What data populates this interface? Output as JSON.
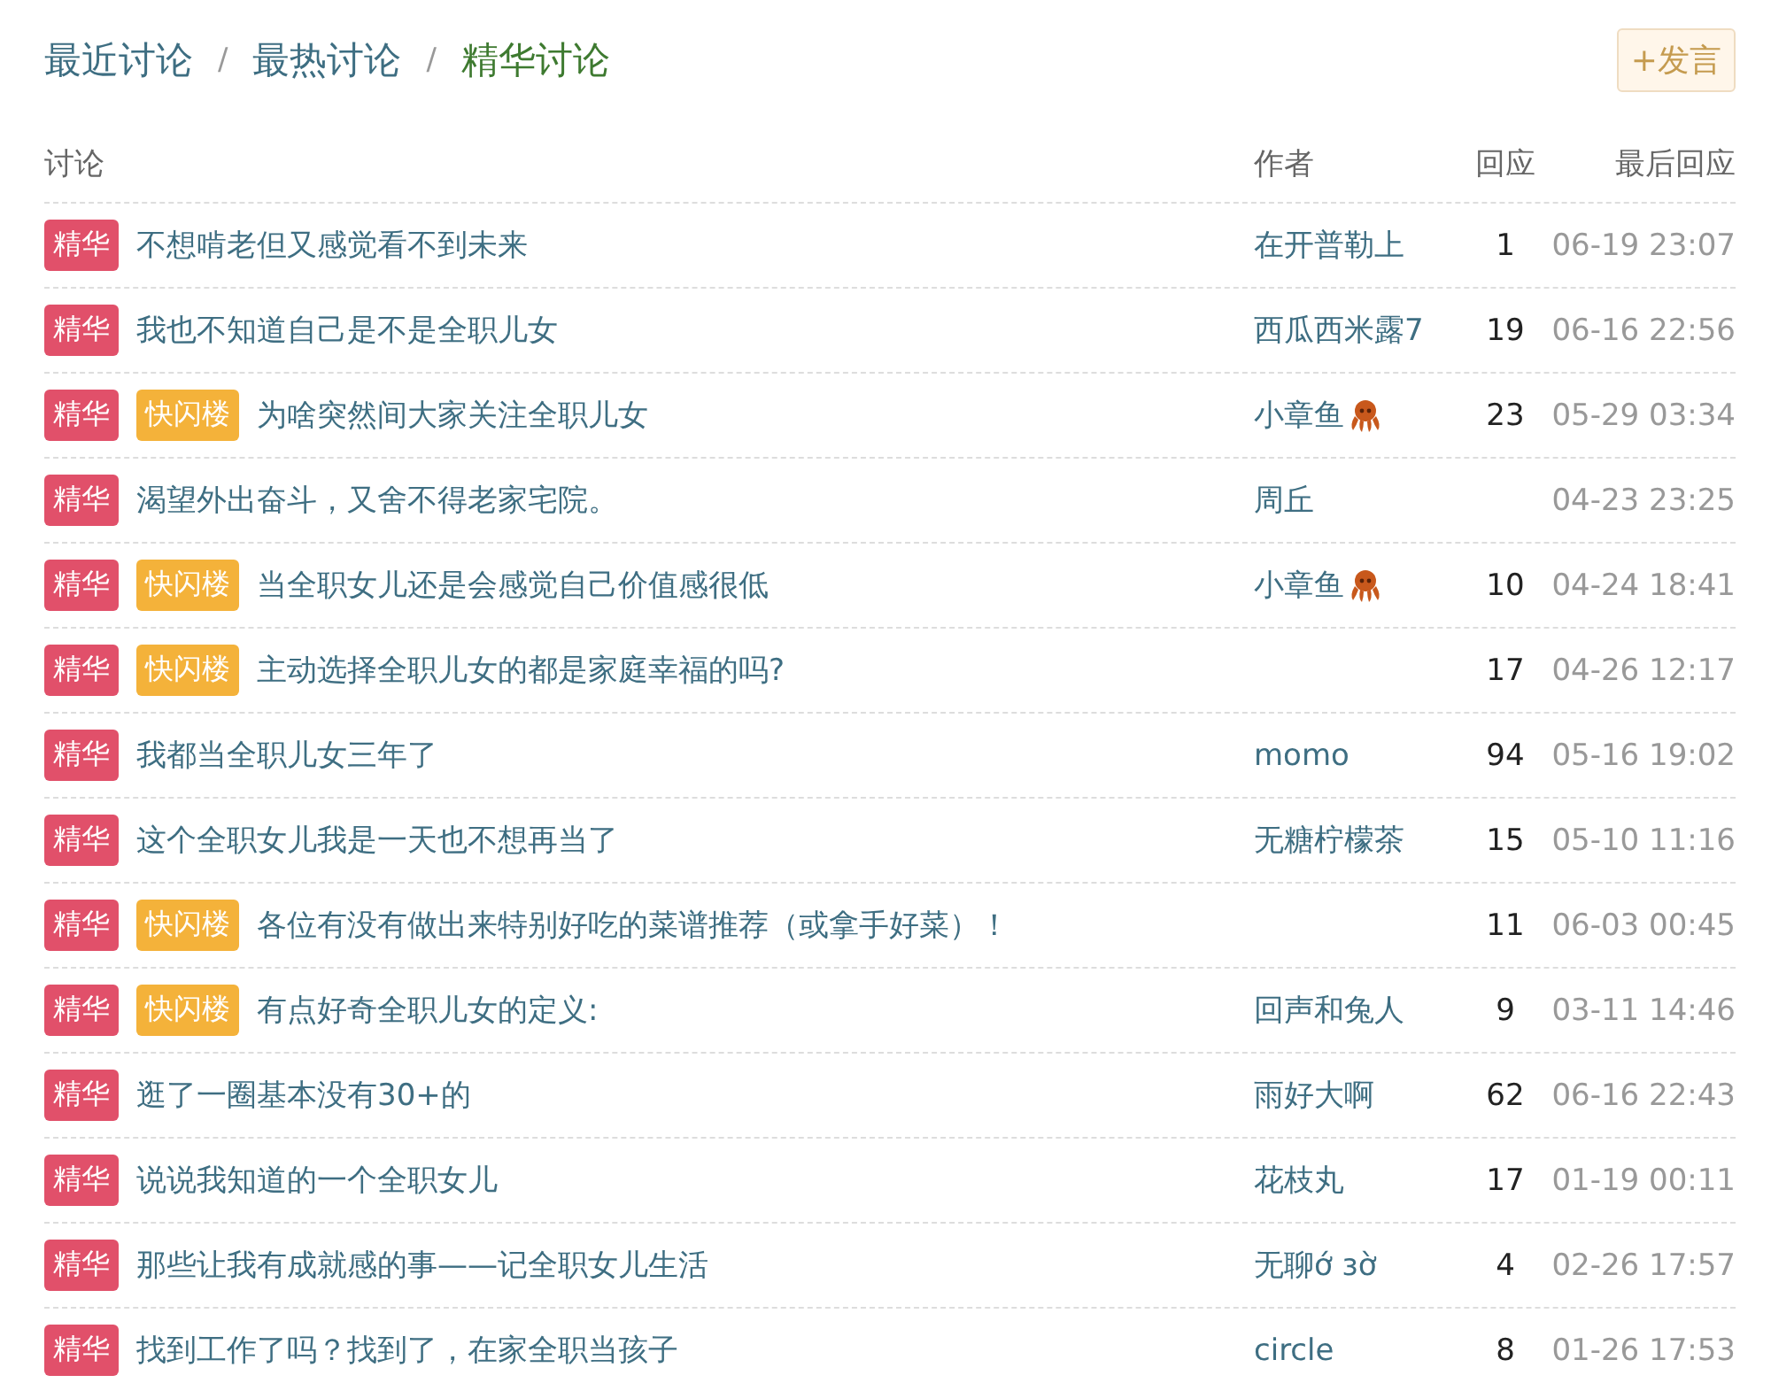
{
  "nav": [
    {
      "label": "最近讨论",
      "selected": false
    },
    {
      "label": "最热讨论",
      "selected": false
    },
    {
      "label": "精华讨论",
      "selected": true
    }
  ],
  "separators": [
    "/",
    "/"
  ],
  "post_button": "+发言",
  "columns": [
    "讨论",
    "作者",
    "回应",
    "最后回应"
  ],
  "rows": [
    {
      "tags": [
        {
          "kind": "elite",
          "label": "精华"
        }
      ],
      "title": "不想啃老但又感觉看不到未来",
      "author": "在开普勒上",
      "replies": "1",
      "last_reply": "06-19 23:07"
    },
    {
      "tags": [
        {
          "kind": "elite",
          "label": "精华"
        }
      ],
      "title": "我也不知道自己是不是全职儿女",
      "author": "西瓜西米露7",
      "replies": "19",
      "last_reply": "06-16 22:56"
    },
    {
      "tags": [
        {
          "kind": "elite",
          "label": "精华"
        },
        {
          "kind": "flash",
          "label": "快闪楼"
        }
      ],
      "title": "为啥突然间大家关注全职儿女",
      "author": "小章鱼",
      "author_badge": true,
      "replies": "23",
      "last_reply": "05-29 03:34"
    },
    {
      "tags": [
        {
          "kind": "elite",
          "label": "精华"
        }
      ],
      "title": "渴望外出奋斗，又舍不得老家宅院。",
      "author": "周丘",
      "last_reply": "04-23 23:25"
    },
    {
      "tags": [
        {
          "kind": "elite",
          "label": "精华"
        },
        {
          "kind": "flash",
          "label": "快闪楼"
        }
      ],
      "title": "当全职女儿还是会感觉自己价值感很低",
      "author": "小章鱼",
      "author_badge": true,
      "replies": "10",
      "last_reply": "04-24 18:41"
    },
    {
      "tags": [
        {
          "kind": "elite",
          "label": "精华"
        },
        {
          "kind": "flash",
          "label": "快闪楼"
        }
      ],
      "title": "主动选择全职儿女的都是家庭幸福的吗?",
      "replies": "17",
      "last_reply": "04-26 12:17"
    },
    {
      "tags": [
        {
          "kind": "elite",
          "label": "精华"
        }
      ],
      "title": "我都当全职儿女三年了",
      "author": "momo",
      "replies": "94",
      "last_reply": "05-16 19:02"
    },
    {
      "tags": [
        {
          "kind": "elite",
          "label": "精华"
        }
      ],
      "title": "这个全职女儿我是一天也不想再当了",
      "author": "无糖柠檬茶",
      "replies": "15",
      "last_reply": "05-10 11:16"
    },
    {
      "tags": [
        {
          "kind": "elite",
          "label": "精华"
        },
        {
          "kind": "flash",
          "label": "快闪楼"
        }
      ],
      "title": "各位有没有做出来特别好吃的菜谱推荐（或拿手好菜）！",
      "replies": "11",
      "last_reply": "06-03 00:45"
    },
    {
      "tags": [
        {
          "kind": "elite",
          "label": "精华"
        },
        {
          "kind": "flash",
          "label": "快闪楼"
        }
      ],
      "title": "有点好奇全职儿女的定义:",
      "author": "回声和兔人",
      "replies": "9",
      "last_reply": "03-11 14:46"
    },
    {
      "tags": [
        {
          "kind": "elite",
          "label": "精华"
        }
      ],
      "title": "逛了一圈基本没有30+的",
      "author": "雨好大啊",
      "replies": "62",
      "last_reply": "06-16 22:43"
    },
    {
      "tags": [
        {
          "kind": "elite",
          "label": "精华"
        }
      ],
      "title": "说说我知道的一个全职女儿",
      "author": "花枝丸",
      "replies": "17",
      "last_reply": "01-19 00:11"
    },
    {
      "tags": [
        {
          "kind": "elite",
          "label": "精华"
        }
      ],
      "title": "那些让我有成就感的事——记全职女儿生活",
      "author": "无聊ớ ɜờ",
      "replies": "4",
      "last_reply": "02-26 17:57"
    },
    {
      "tags": [
        {
          "kind": "elite",
          "label": "精华"
        }
      ],
      "title": "找到工作了吗？找到了，在家全职当孩子",
      "author": "circle",
      "replies": "8",
      "last_reply": "01-26 17:53"
    }
  ]
}
